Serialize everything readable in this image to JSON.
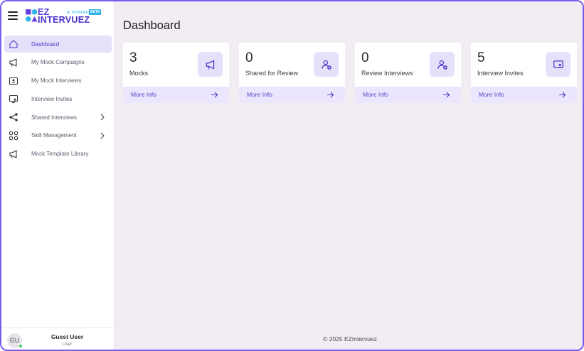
{
  "brand": {
    "line1": "EZ",
    "line2": "INTERVUEZ",
    "ai_powered": "AI POWERED",
    "beta": "BETA"
  },
  "sidebar": {
    "items": [
      {
        "label": "Dashboard",
        "icon": "home-icon",
        "active": true
      },
      {
        "label": "My Mock Campaigns",
        "icon": "megaphone-icon",
        "active": false
      },
      {
        "label": "My Mock Interviews",
        "icon": "interview-card-icon",
        "active": false
      },
      {
        "label": "Interview Invites",
        "icon": "invite-screen-icon",
        "active": false
      },
      {
        "label": "Shared Interviews",
        "icon": "share-icon",
        "active": false,
        "expandable": true
      },
      {
        "label": "Skill Management",
        "icon": "grid-circles-icon",
        "active": false,
        "expandable": true
      },
      {
        "label": "Mock Template Library",
        "icon": "megaphone-icon",
        "active": false
      }
    ],
    "user": {
      "initials": "GU",
      "name": "Guest User",
      "role": "User"
    }
  },
  "main": {
    "title": "Dashboard",
    "cards": [
      {
        "count": "3",
        "label": "Mocks",
        "icon": "megaphone-icon",
        "more": "More Info"
      },
      {
        "count": "0",
        "label": "Shared for Review",
        "icon": "user-share-icon",
        "more": "More Info"
      },
      {
        "count": "0",
        "label": "Review Interviews",
        "icon": "user-review-icon",
        "more": "More Info"
      },
      {
        "count": "5",
        "label": "Interview Invites",
        "icon": "invite-screen-icon",
        "more": "More Info"
      }
    ]
  },
  "footer": {
    "text": "© 2025 EZIntervuez"
  },
  "colors": {
    "accent": "#5b3fd6",
    "active_bg": "#e6e0fb",
    "frame": "#7b5cf0",
    "page_bg": "#f1edf3"
  }
}
